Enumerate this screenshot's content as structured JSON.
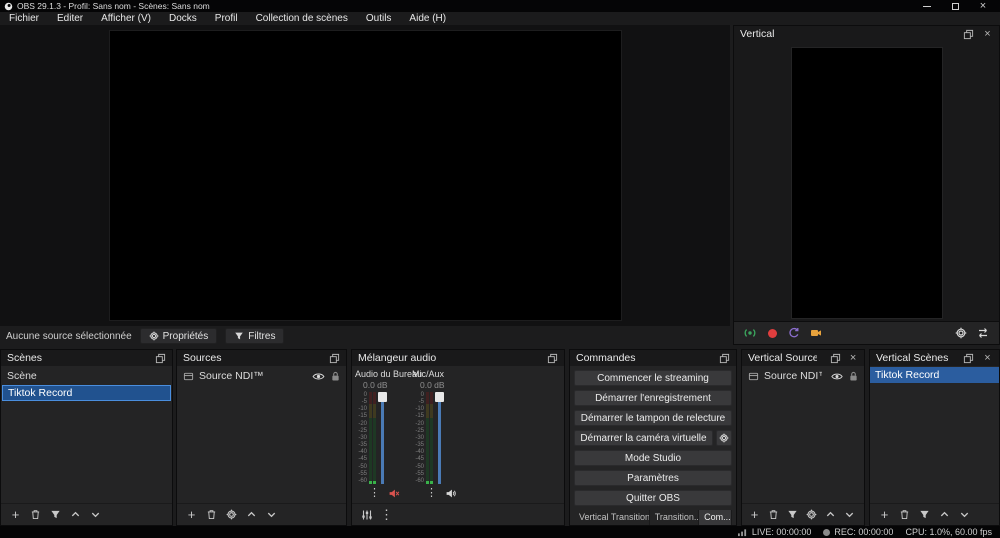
{
  "window": {
    "title": "OBS 29.1.3 - Profil: Sans nom - Scènes: Sans nom"
  },
  "menu": {
    "items": [
      "Fichier",
      "Editer",
      "Afficher (V)",
      "Docks",
      "Profil",
      "Collection de scènes",
      "Outils",
      "Aide (H)"
    ]
  },
  "selection_bar": {
    "status": "Aucune source sélectionnée",
    "properties": "Propriétés",
    "filters": "Filtres"
  },
  "scenes_dock": {
    "title": "Scènes",
    "items": [
      "Scène",
      "Tiktok Record"
    ],
    "selected": "Tiktok Record"
  },
  "sources_dock": {
    "title": "Sources",
    "items": [
      "Source NDI™"
    ]
  },
  "mixer_dock": {
    "title": "Mélangeur audio",
    "channels": [
      {
        "name": "Audio du Bureau",
        "volume": "0.0 dB",
        "muted": true
      },
      {
        "name": "Mic/Aux",
        "volume": "0.0 dB",
        "muted": false
      }
    ],
    "scale_ticks": [
      "0",
      "-5",
      "-10",
      "-15",
      "-20",
      "-25",
      "-30",
      "-35",
      "-40",
      "-45",
      "-50",
      "-55",
      "-60"
    ]
  },
  "commands_dock": {
    "title": "Commandes",
    "buttons": [
      "Commencer le streaming",
      "Démarrer l'enregistrement",
      "Démarrer le tampon de relecture",
      "Démarrer la caméra virtuelle",
      "Mode Studio",
      "Paramètres",
      "Quitter OBS"
    ],
    "tabs": [
      "Vertical Transition...",
      "Transition...",
      "Com..."
    ],
    "active_tab": "Com..."
  },
  "vertical_dock": {
    "title": "Vertical"
  },
  "vertical_sources_dock": {
    "title": "Vertical Sources",
    "items": [
      "Source NDI™"
    ]
  },
  "vertical_scenes_dock": {
    "title": "Vertical Scènes",
    "items": [
      "Tiktok Record"
    ],
    "selected": "Tiktok Record"
  },
  "status_bar": {
    "live": "LIVE: 00:00:00",
    "rec": "REC: 00:00:00",
    "cpu": "CPU: 1.0%, 60.00 fps"
  },
  "icons": {
    "plus": "+",
    "kebab": "⋮",
    "close": "×"
  },
  "colors": {
    "selection_blue": "#2b5d9f",
    "record_red": "#e03e3e",
    "stream_green": "#3ba55d",
    "backtrack_purple": "#8d6fd1",
    "camera_orange": "#e8a33d"
  }
}
